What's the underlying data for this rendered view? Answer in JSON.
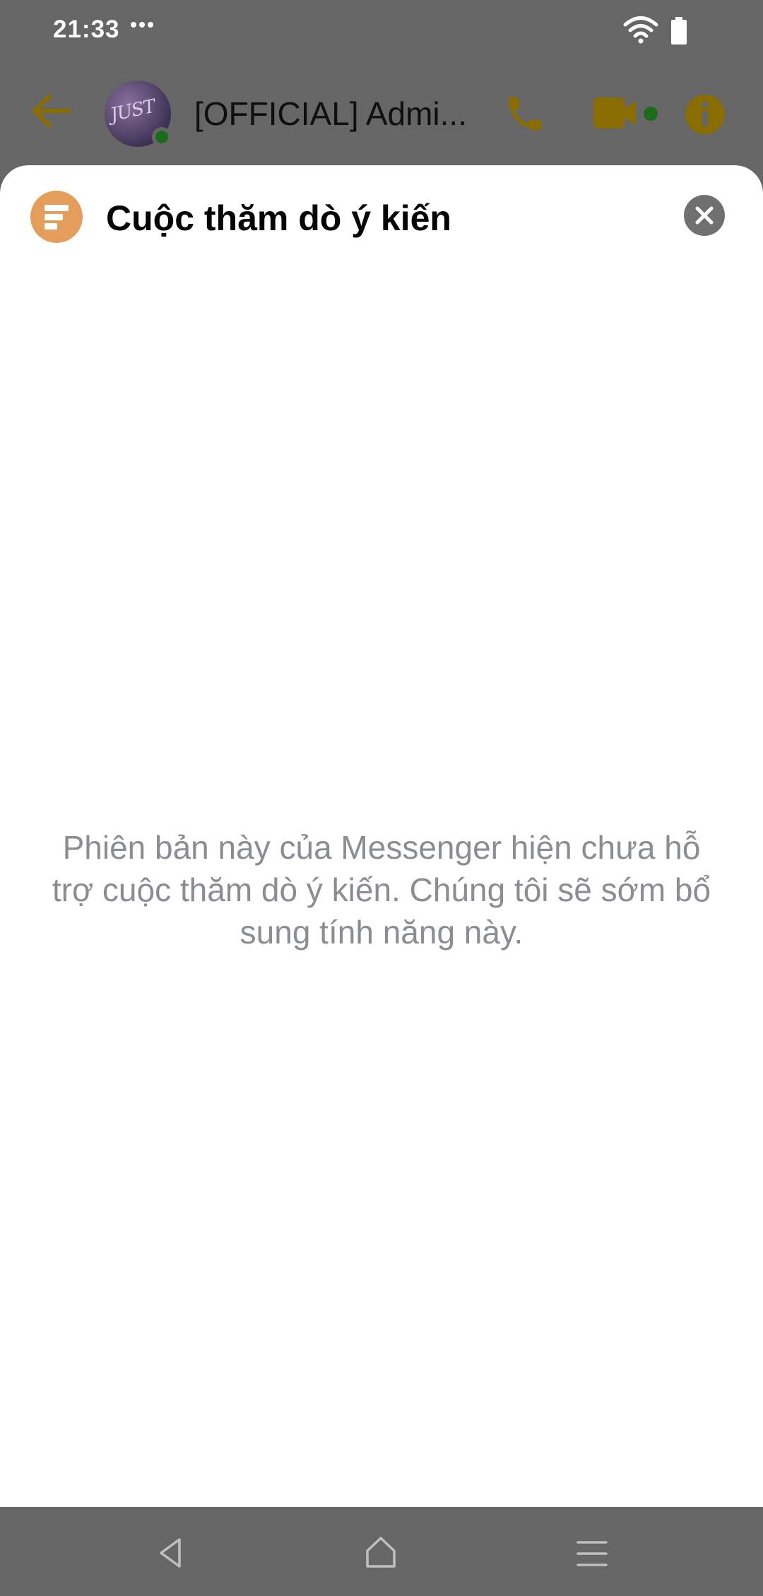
{
  "status_bar": {
    "time": "21:33",
    "overflow_icon": "more-dots-icon",
    "wifi_icon": "wifi-icon",
    "battery_icon": "battery-icon"
  },
  "chat_header": {
    "title": "[OFFICIAL] Admi...",
    "avatar_text": "JUST",
    "back_icon": "arrow-back-icon",
    "call_icon": "phone-icon",
    "video_icon": "video-camera-icon",
    "info_icon": "info-icon",
    "accent_color": "#8a6d00",
    "online_color": "#1b6b1b"
  },
  "sheet": {
    "icon": "poll-icon",
    "icon_color": "#e59d5c",
    "title": "Cuộc thăm dò ý kiến",
    "close_icon": "close-icon",
    "message": "Phiên bản này của Messenger hiện chưa hỗ trợ cuộc thăm dò ý kiến. Chúng tôi sẽ sớm bổ sung tính năng này."
  },
  "nav_bar": {
    "back_icon": "nav-back-icon",
    "home_icon": "nav-home-icon",
    "menu_icon": "nav-menu-icon"
  }
}
